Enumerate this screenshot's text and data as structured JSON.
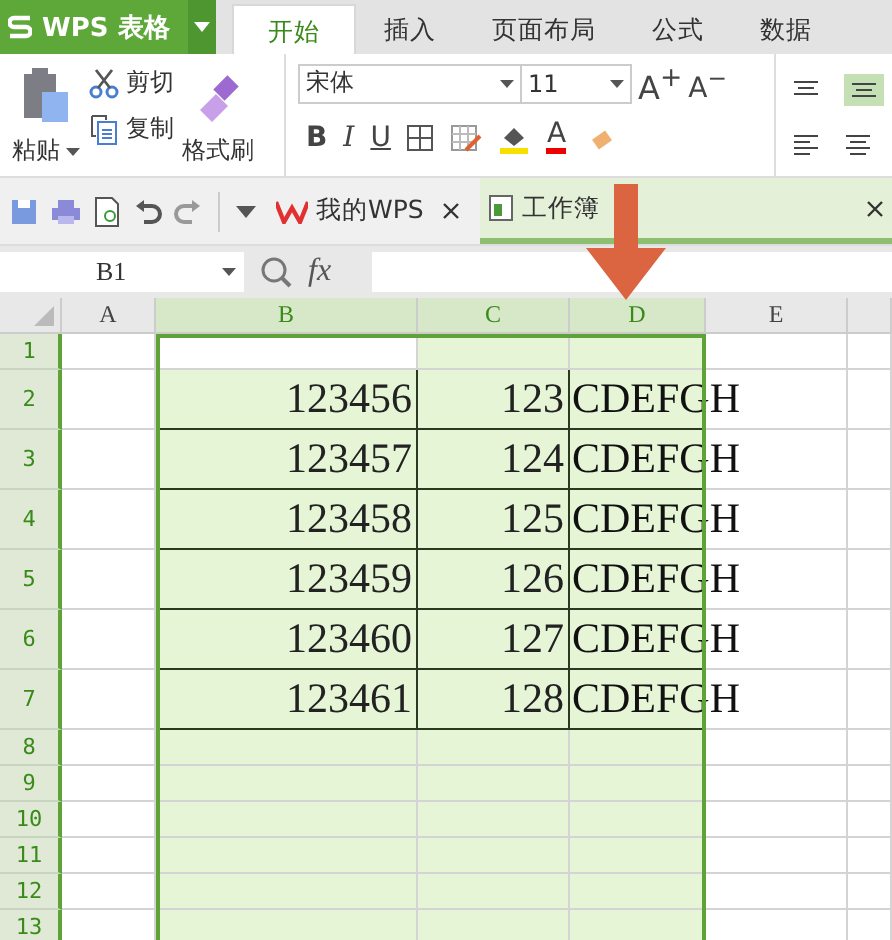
{
  "app_menu": {
    "label": "WPS 表格"
  },
  "ribbon_tabs": [
    {
      "label": "开始",
      "selected": true
    },
    {
      "label": "插入",
      "selected": false
    },
    {
      "label": "页面布局",
      "selected": false
    },
    {
      "label": "公式",
      "selected": false
    },
    {
      "label": "数据",
      "selected": false
    }
  ],
  "clipboard": {
    "paste": "粘贴",
    "cut": "剪切",
    "copy": "复制",
    "format_painter": "格式刷"
  },
  "font": {
    "name": "宋体",
    "size": "11",
    "grow": "A$^{+}$",
    "shrink": "A$^{−}$",
    "bold": "B",
    "italic": "I",
    "underline": "U",
    "color_glyph": "A"
  },
  "doc_tabs": [
    {
      "label": "我的WPS",
      "selected": false
    },
    {
      "label": "工作簿",
      "selected": true
    }
  ],
  "name_box": "B1",
  "fx": "fx",
  "columns": [
    {
      "label": "A",
      "selected": false
    },
    {
      "label": "B",
      "selected": true
    },
    {
      "label": "C",
      "selected": true
    },
    {
      "label": "D",
      "selected": true
    },
    {
      "label": "E",
      "selected": false
    }
  ],
  "rows": [
    {
      "label": "1",
      "tall": false,
      "bordered": false
    },
    {
      "label": "2",
      "tall": true,
      "bordered": true,
      "b": "123456",
      "c": "123",
      "d": "CDEFGH"
    },
    {
      "label": "3",
      "tall": true,
      "bordered": true,
      "b": "123457",
      "c": "124",
      "d": "CDEFGH"
    },
    {
      "label": "4",
      "tall": true,
      "bordered": true,
      "b": "123458",
      "c": "125",
      "d": "CDEFGH"
    },
    {
      "label": "5",
      "tall": true,
      "bordered": true,
      "b": "123459",
      "c": "126",
      "d": "CDEFGH"
    },
    {
      "label": "6",
      "tall": true,
      "bordered": true,
      "b": "123460",
      "c": "127",
      "d": "CDEFGH"
    },
    {
      "label": "7",
      "tall": true,
      "bordered": true,
      "b": "123461",
      "c": "128",
      "d": "CDEFGH"
    },
    {
      "label": "8",
      "tall": false,
      "bordered": false
    },
    {
      "label": "9",
      "tall": false,
      "bordered": false
    },
    {
      "label": "10",
      "tall": false,
      "bordered": false
    },
    {
      "label": "11",
      "tall": false,
      "bordered": false
    },
    {
      "label": "12",
      "tall": false,
      "bordered": false
    },
    {
      "label": "13",
      "tall": false,
      "bordered": false
    }
  ]
}
